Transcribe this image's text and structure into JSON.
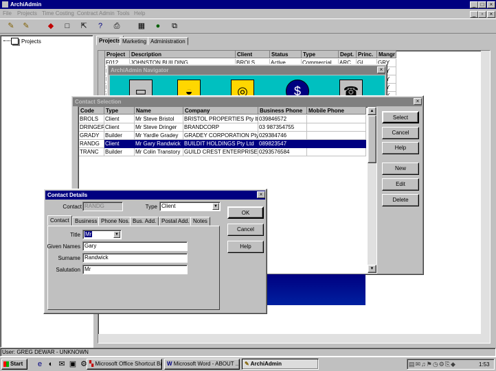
{
  "app": {
    "title": "ArchiAdmin",
    "menu": [
      "File",
      "Projects",
      "Time Costing",
      "Contract Admin",
      "Tools",
      "Help"
    ]
  },
  "toolbar": {
    "icons": [
      "open-folder",
      "open-folder-2",
      "eraser",
      "new-document",
      "export",
      "help",
      "print",
      "calculator",
      "globe",
      "copy"
    ]
  },
  "tree": {
    "item": "Projects"
  },
  "main_tabs": [
    "Projects",
    "Marketing",
    "Administration"
  ],
  "projects": {
    "columns": [
      "Project",
      "Description",
      "Client",
      "Status",
      "Type",
      "Dept.",
      "Princ.",
      "Mangr"
    ],
    "rows": [
      [
        "F012",
        "JOHNSTON BUILDING",
        "BROLS",
        "Active",
        "Commercial",
        "ARC",
        "GL",
        "GRY"
      ],
      [
        "F",
        "",
        "",
        "",
        "",
        "",
        "",
        "GRY"
      ],
      [
        "F",
        "",
        "",
        "",
        "",
        "",
        "",
        "GRY"
      ],
      [
        "F",
        "",
        "",
        "",
        "",
        "",
        "",
        "GRY"
      ],
      [
        "F",
        "",
        "",
        "",
        "",
        "",
        "",
        "GRY"
      ]
    ]
  },
  "navigator": {
    "title": "ArchiAdmin Navigator"
  },
  "contact_selection": {
    "title": "Contact Selection",
    "columns": [
      "Code",
      "Type",
      "Name",
      "Company",
      "Business Phone",
      "Mobile Phone"
    ],
    "rows": [
      {
        "code": "BROLS",
        "type": "Client",
        "name": "Mr Steve Bristol",
        "company": "BRISTOL PROPERTIES Pty ltd",
        "phone": "039846572",
        "mobile": ""
      },
      {
        "code": "DRINGER",
        "type": "Client",
        "name": "Mr Steve Dringer",
        "company": "BRANDCORP",
        "phone": "03 987354755",
        "mobile": ""
      },
      {
        "code": "GRADY",
        "type": "Builder",
        "name": "Mr Yardle Gradey",
        "company": "GRADEY CORPORATION Pty L",
        "phone": "029384746",
        "mobile": ""
      },
      {
        "code": "RANDG",
        "type": "Client",
        "name": "Mr Gary Randwick",
        "company": "BUILDIT HOLDINGS Pty Ltd",
        "phone": "089823547",
        "mobile": ""
      },
      {
        "code": "TRANC",
        "type": "Builder",
        "name": "Mr Colin Transtory",
        "company": "GUILD CREST ENTERPRISES",
        "phone": "0293576584",
        "mobile": ""
      }
    ],
    "selected_index": 3,
    "buttons": {
      "select": "Select",
      "cancel": "Cancel",
      "help": "Help",
      "new": "New",
      "edit": "Edit",
      "delete": "Delete"
    }
  },
  "contact_details": {
    "title": "Contact Details",
    "contact_label": "Contact",
    "contact_value": "RANDG",
    "type_label": "Type",
    "type_value": "Client",
    "tabs": [
      "Contact",
      "Business",
      "Phone Nos.",
      "Bus. Add.",
      "Postal Add.",
      "Notes"
    ],
    "title_label": "Title",
    "title_value": "Mr",
    "given_label": "Given Names",
    "given_value": "Gary",
    "surname_label": "Surname",
    "surname_value": "Randwick",
    "salutation_label": "Salutation",
    "salutation_value": "Mr",
    "buttons": {
      "ok": "OK",
      "cancel": "Cancel",
      "help": "Help"
    }
  },
  "status": {
    "user": "User: GREG DEWAR - UNKNOWN"
  },
  "taskbar": {
    "start": "Start",
    "tasks": [
      "Microsoft Office Shortcut Bar",
      "Microsoft Word - ABOUT ...",
      "ArchiAdmin"
    ],
    "clock": "1:53"
  }
}
